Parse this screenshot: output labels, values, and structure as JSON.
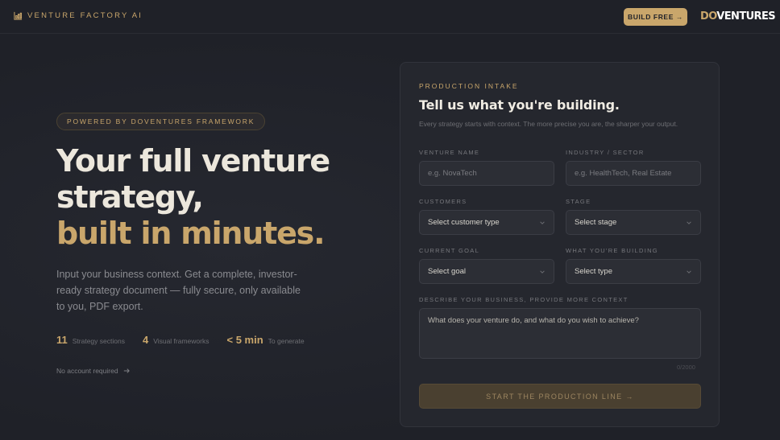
{
  "header": {
    "brand_name": "VENTURE FACTORY AI",
    "brand_icon": "bar-chart-icon",
    "build_button": "BUILD FREE →",
    "logo_do": "DO",
    "logo_rest": "VENTURES"
  },
  "hero": {
    "pill": "POWERED BY DOVENTURES FRAMEWORK",
    "line1": "Your full venture",
    "line2": "strategy,",
    "line3": "built in minutes.",
    "subtext": "Input your business context. Get a complete, investor-ready strategy document — fully secure, only available to you, PDF export.",
    "stats": [
      {
        "num": "11",
        "label": "Strategy sections"
      },
      {
        "num": "4",
        "label": "Visual frameworks"
      },
      {
        "num": "< 5 min",
        "label": "To generate"
      }
    ],
    "no_account": "No account required"
  },
  "form": {
    "eyebrow": "PRODUCTION INTAKE",
    "title": "Tell us what you're building.",
    "description": "Every strategy starts with context. The more precise you are, the sharper your output.",
    "venture_name": {
      "label": "VENTURE NAME",
      "placeholder": "e.g. NovaTech"
    },
    "industry": {
      "label": "INDUSTRY / SECTOR",
      "placeholder": "e.g. HealthTech, Real Estate"
    },
    "customers": {
      "label": "CUSTOMERS",
      "value": "Select customer type"
    },
    "stage": {
      "label": "STAGE",
      "value": "Select stage"
    },
    "goal": {
      "label": "CURRENT GOAL",
      "value": "Select goal"
    },
    "building": {
      "label": "WHAT YOU'RE BUILDING",
      "value": "Select type"
    },
    "context": {
      "label": "DESCRIBE YOUR BUSINESS, PROVIDE MORE CONTEXT",
      "placeholder": "What does your venture do, and what do you wish to achieve?"
    },
    "counter": "0/2000",
    "submit": "START THE PRODUCTION LINE →"
  },
  "colors": {
    "background": "#1f2128",
    "accent": "#c9a66b",
    "card": "#25272e"
  }
}
